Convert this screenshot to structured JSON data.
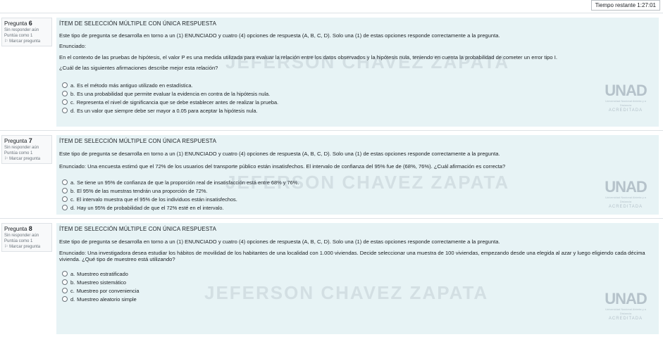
{
  "timer": "Tiempo restante 1:27:01",
  "watermark": "JEFERSON CHAVEZ ZAPATA",
  "logo": {
    "big": "UNAD",
    "small": "Universidad Nacional Abierta y a Distancia",
    "acr": "ACREDITADA"
  },
  "questions": [
    {
      "number_label": "Pregunta",
      "number": "6",
      "status": "Sin responder aún",
      "points": "Puntúa como 1",
      "flag": "Marcar pregunta",
      "heading": "ÍTEM DE SELECCIÓN MÚLTIPLE CON ÚNICA RESPUESTA",
      "intro": "Este tipo de pregunta se desarrolla en torno a un (1) ENUNCIADO y cuatro (4) opciones de respuesta (A, B, C, D). Solo una (1) de estas opciones responde correctamente a la pregunta.",
      "enunciado_label": "Enunciado:",
      "statement": "En el contexto de las pruebas de hipótesis, el valor P es una medida utilizada para evaluar la relación entre los datos observados y la hipótesis nula, teniendo en cuenta la probabilidad de cometer un error tipo I.",
      "question": "¿Cuál de las siguientes afirmaciones describe mejor esta relación?",
      "options": [
        {
          "letter": "a.",
          "text": "Es el método más antiguo utilizado en estadística."
        },
        {
          "letter": "b.",
          "text": "Es una probabilidad que permite evaluar la evidencia en contra de la hipótesis nula."
        },
        {
          "letter": "c.",
          "text": "Representa el nivel de significancia que se debe establecer antes de realizar la prueba."
        },
        {
          "letter": "d.",
          "text": "Es un valor que siempre debe ser mayor a 0.05 para aceptar la hipótesis nula."
        }
      ]
    },
    {
      "number_label": "Pregunta",
      "number": "7",
      "status": "Sin responder aún",
      "points": "Puntúa como 1",
      "flag": "Marcar pregunta",
      "heading": "ÍTEM DE SELECCIÓN MÚLTIPLE CON ÚNICA RESPUESTA",
      "intro": "Este tipo de pregunta se desarrolla en torno a un (1) ENUNCIADO y cuatro (4) opciones de respuesta (A, B, C, D). Solo una (1) de estas opciones responde correctamente a la pregunta.",
      "statement": "Enunciado: Una encuesta estimó que el 72% de los usuarios del transporte público están insatisfechos. El intervalo de confianza del 95% fue de (68%, 76%). ¿Cuál afirmación es correcta?",
      "options": [
        {
          "letter": "a.",
          "text": "Se tiene un 95% de confianza de que la proporción real de insatisfacción está entre 68% y 76%."
        },
        {
          "letter": "b.",
          "text": "El 95% de las muestras tendrán una proporción de 72%."
        },
        {
          "letter": "c.",
          "text": "El intervalo muestra que el 95% de los individuos están insatisfechos."
        },
        {
          "letter": "d.",
          "text": "Hay un 95% de probabilidad de que el 72% esté en el intervalo."
        }
      ]
    },
    {
      "number_label": "Pregunta",
      "number": "8",
      "status": "Sin responder aún",
      "points": "Puntúa como 1",
      "flag": "Marcar pregunta",
      "heading": "ÍTEM DE SELECCIÓN MÚLTIPLE CON ÚNICA RESPUESTA",
      "intro": "Este tipo de pregunta se desarrolla en torno a un (1) ENUNCIADO y cuatro (4) opciones de respuesta (A, B, C, D). Solo una (1) de estas opciones responde correctamente a la pregunta.",
      "statement": "Enunciado: Una investigadora desea estudiar los hábitos de movilidad de los habitantes de una localidad con 1.000 viviendas. Decide seleccionar una muestra de 100 viviendas, empezando desde una elegida al azar y luego eligiendo cada décima vivienda. ¿Qué tipo de muestreo está utilizando?",
      "options": [
        {
          "letter": "a.",
          "text": "Muestreo estratificado"
        },
        {
          "letter": "b.",
          "text": "Muestreo sistemático"
        },
        {
          "letter": "c.",
          "text": "Muestreo por conveniencia"
        },
        {
          "letter": "d.",
          "text": "Muestreo aleatorio simple"
        }
      ]
    }
  ]
}
